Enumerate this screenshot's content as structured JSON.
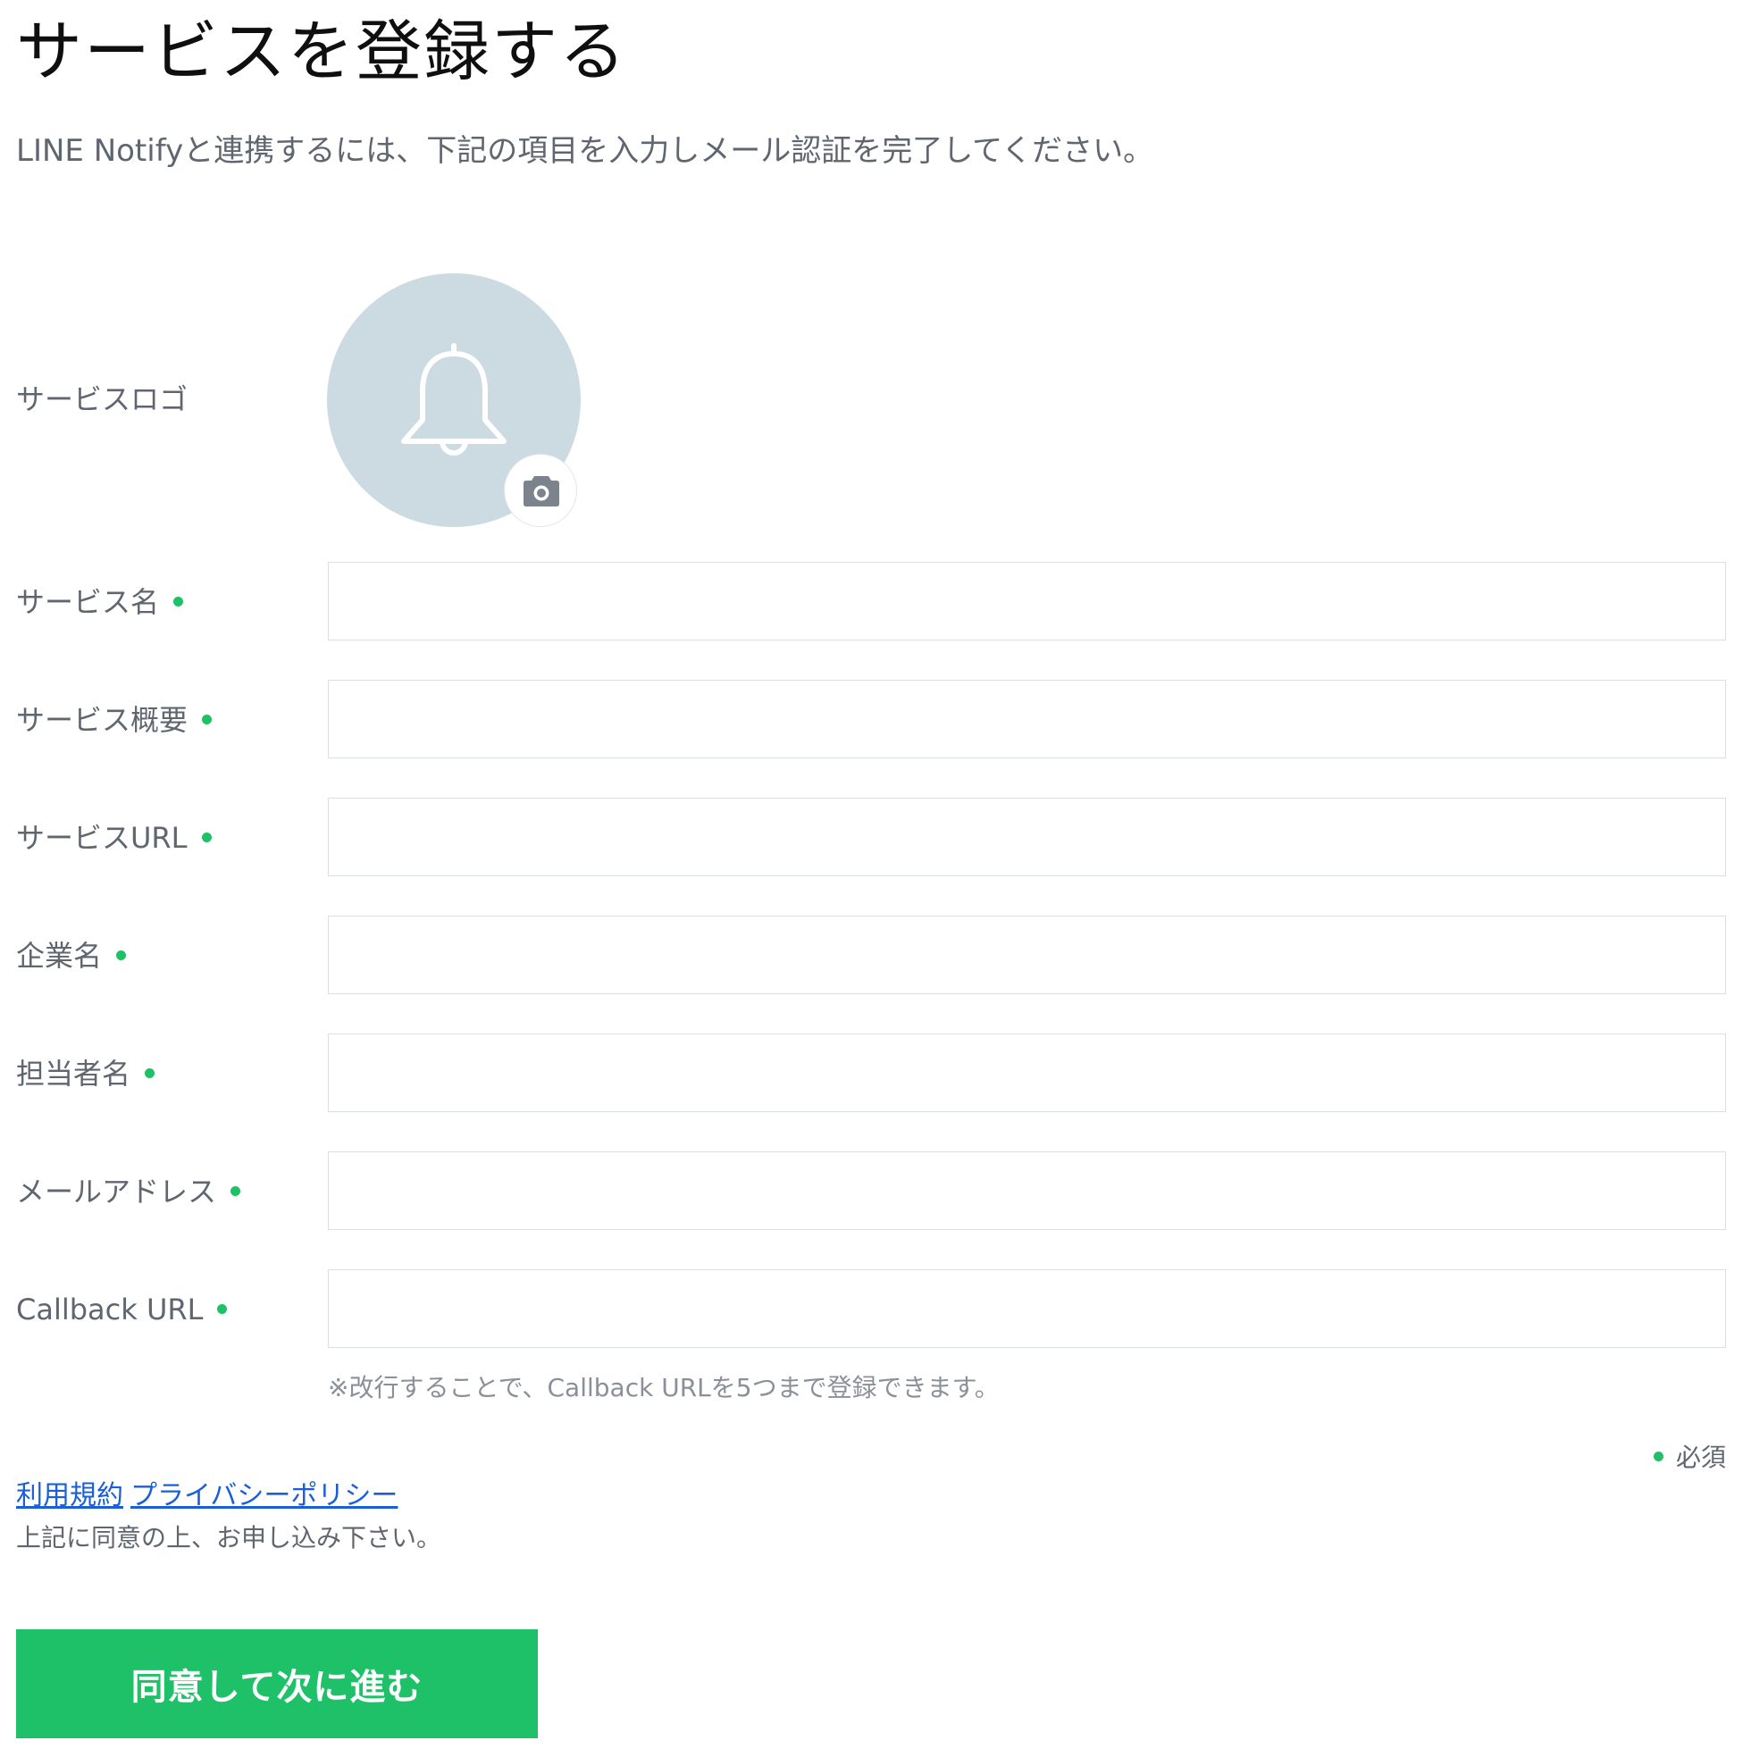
{
  "page": {
    "title": "サービスを登録する",
    "description": "LINE Notifyと連携するには、下記の項目を入力しメール認証を完了してください。"
  },
  "logo": {
    "label": "サービスロゴ",
    "placeholder_icon": "bell-icon",
    "upload_icon": "camera-icon",
    "circle_color": "#ccdae1"
  },
  "fields": [
    {
      "label": "サービス名",
      "required": true,
      "value": ""
    },
    {
      "label": "サービス概要",
      "required": true,
      "value": ""
    },
    {
      "label": "サービスURL",
      "required": true,
      "value": ""
    },
    {
      "label": "企業名",
      "required": true,
      "value": ""
    },
    {
      "label": "担当者名",
      "required": true,
      "value": ""
    },
    {
      "label": "メールアドレス",
      "required": true,
      "value": ""
    },
    {
      "label": "Callback URL",
      "required": true,
      "value": ""
    }
  ],
  "callback_note": "※改行することで、Callback URLを5つまで登録できます。",
  "required_legend": "必須",
  "links": {
    "terms": "利用規約",
    "privacy": "プライバシーポリシー"
  },
  "agree_text": "上記に同意の上、お申し込み下さい。",
  "submit_label": "同意して次に進む",
  "colors": {
    "accent": "#1ec168",
    "link": "#1a5fd8",
    "input_border": "#dadfe3"
  }
}
